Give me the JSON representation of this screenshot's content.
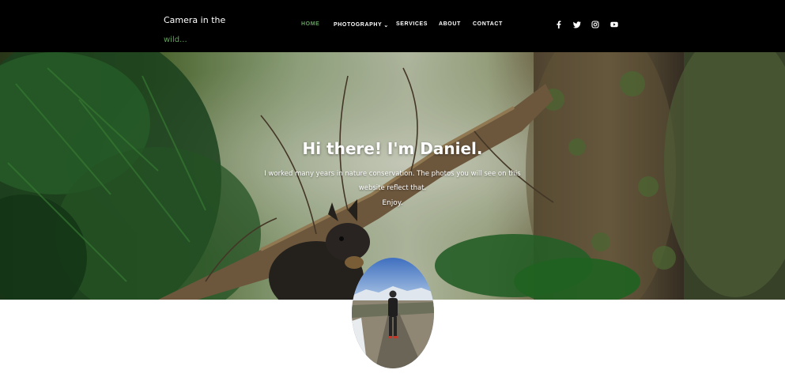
{
  "brand": {
    "line1": "Camera in the",
    "line2": "wild..."
  },
  "nav": {
    "items": [
      {
        "label": "HOME",
        "active": true
      },
      {
        "label": "PHOTOGRAPHY",
        "has_dropdown": true
      },
      {
        "label": "SERVICES"
      },
      {
        "label": "ABOUT"
      },
      {
        "label": "CONTACT"
      }
    ],
    "dropdown_caret": "⌄"
  },
  "social": [
    "facebook-icon",
    "twitter-icon",
    "instagram-icon",
    "youtube-icon"
  ],
  "hero": {
    "title": "Hi there! I'm Daniel.",
    "subtitle": "I worked many years in nature conservation. The photos you will see on this website reflect that.",
    "enjoy": "Enjoy."
  },
  "colors": {
    "accent": "#5fa05a",
    "topbar": "#000000",
    "text": "#ffffff"
  }
}
